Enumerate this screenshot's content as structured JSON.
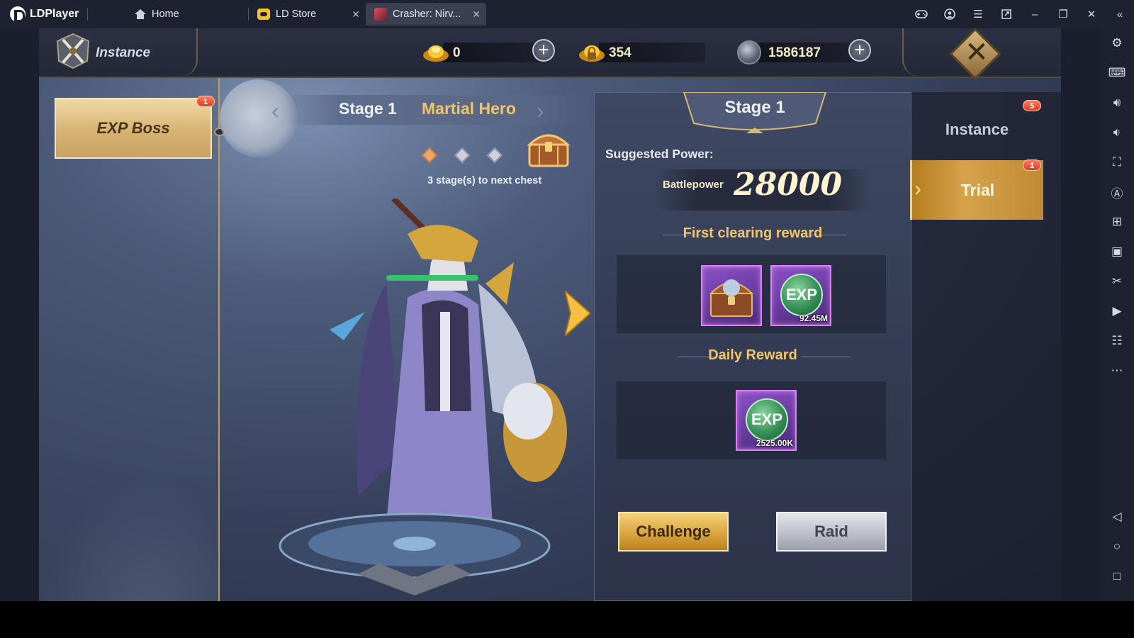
{
  "emulator": {
    "brand": "LDPlayer",
    "tabs": [
      {
        "label": "Home"
      },
      {
        "label": "LD Store"
      },
      {
        "label": "Crasher: Nirv..."
      }
    ]
  },
  "game": {
    "header": {
      "title": "Instance",
      "resources": [
        {
          "icon": "gold-ingot-icon",
          "value": "0"
        },
        {
          "icon": "bound-gold-icon",
          "value": "354"
        },
        {
          "icon": "silver-coin-icon",
          "value": "1586187"
        }
      ]
    },
    "left_panel": {
      "item_label": "EXP Boss",
      "item_badge": "1"
    },
    "stage_ribbon": {
      "stage": "Stage 1",
      "hero": "Martial Hero",
      "progress_note": "3 stage(s) to next chest"
    },
    "detail": {
      "stage_title": "Stage 1",
      "suggested_power_label": "Suggested Power:",
      "battlepower_label": "Battlepower",
      "battlepower_value": "28000",
      "first_clear_title": "First clearing reward",
      "first_clear_items": [
        {
          "icon": "treasure-chest-icon",
          "qty": ""
        },
        {
          "icon": "exp-orb-icon",
          "label": "EXP",
          "qty": "92.45M"
        }
      ],
      "daily_title": "Daily Reward",
      "daily_items": [
        {
          "icon": "exp-orb-icon",
          "label": "EXP",
          "qty": "2525.00K"
        }
      ],
      "challenge_label": "Challenge",
      "raid_label": "Raid"
    },
    "right_tabs": {
      "instance_label": "Instance",
      "instance_badge": "5",
      "trial_label": "Trial",
      "trial_badge": "1"
    }
  },
  "colors": {
    "accent_gold": "#f0c66b",
    "badge_red": "#d9402b",
    "reward_purple": "#8b51c7"
  }
}
